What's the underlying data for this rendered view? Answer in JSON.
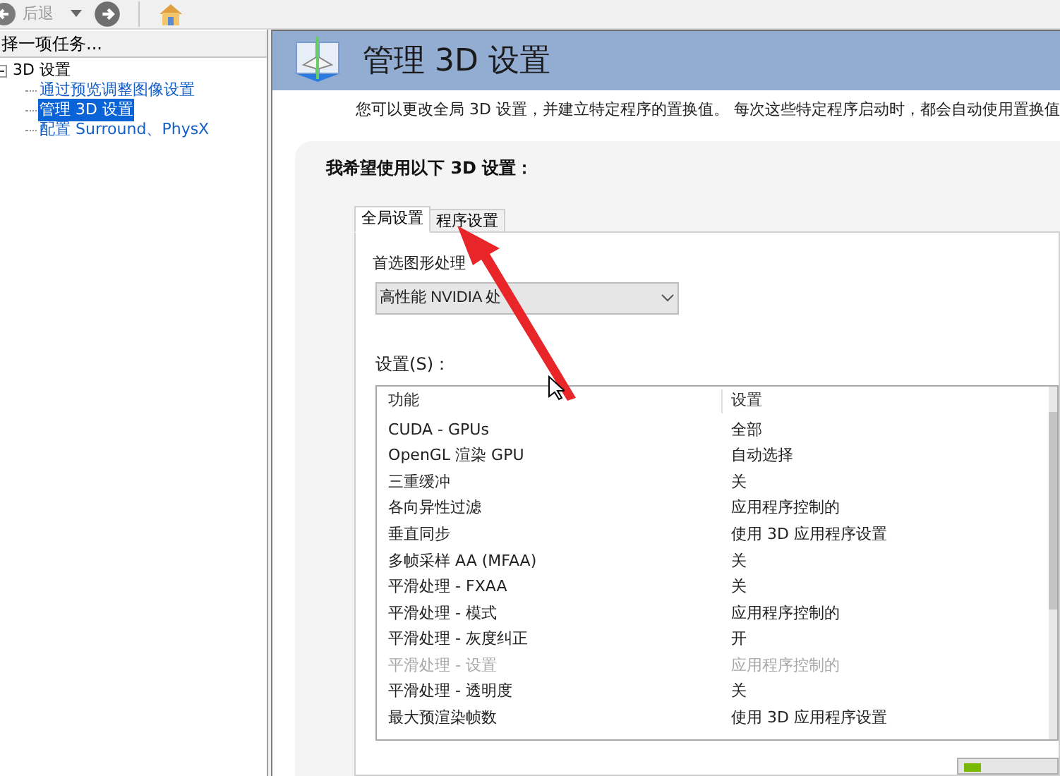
{
  "toolbar": {
    "back_label": "后退"
  },
  "task_panel": {
    "title": "择一项任务...",
    "tree": [
      {
        "label": "3D 设置",
        "expanded": true,
        "selected": false,
        "children": [
          {
            "label": "通过预览调整图像设置",
            "selected": false
          },
          {
            "label": "管理 3D 设置",
            "selected": true
          },
          {
            "label": "配置 Surround、PhysX",
            "selected": false
          }
        ]
      }
    ]
  },
  "page": {
    "title": "管理 3D 设置",
    "description": "您可以更改全局 3D 设置，并建立特定程序的置换值。 每次这些特定程序启动时，都会自动使用置换值",
    "section_title": "我希望使用以下 3D 设置：",
    "tabs": [
      {
        "label": "全局设置",
        "selected": true
      },
      {
        "label": "程序设置",
        "selected": false
      }
    ],
    "gpu_label": "首选图形处理",
    "gpu_value": "高性能 NVIDIA 处",
    "settings_label": "设置(S)：",
    "table": {
      "columns": [
        "功能",
        "设置"
      ],
      "rows": [
        {
          "feature": "CUDA - GPUs",
          "value": "全部",
          "disabled": false
        },
        {
          "feature": "OpenGL 渲染 GPU",
          "value": "自动选择",
          "disabled": false
        },
        {
          "feature": "三重缓冲",
          "value": "关",
          "disabled": false
        },
        {
          "feature": "各向异性过滤",
          "value": "应用程序控制的",
          "disabled": false
        },
        {
          "feature": "垂直同步",
          "value": "使用 3D 应用程序设置",
          "disabled": false
        },
        {
          "feature": "多帧采样 AA (MFAA)",
          "value": "关",
          "disabled": false
        },
        {
          "feature": "平滑处理 - FXAA",
          "value": "关",
          "disabled": false
        },
        {
          "feature": "平滑处理 - 模式",
          "value": "应用程序控制的",
          "disabled": false
        },
        {
          "feature": "平滑处理 - 灰度纠正",
          "value": "开",
          "disabled": false
        },
        {
          "feature": "平滑处理 - 设置",
          "value": "应用程序控制的",
          "disabled": true
        },
        {
          "feature": "平滑处理 - 透明度",
          "value": "关",
          "disabled": false
        },
        {
          "feature": "最大预渲染帧数",
          "value": "使用 3D 应用程序设置",
          "disabled": false
        }
      ]
    }
  }
}
